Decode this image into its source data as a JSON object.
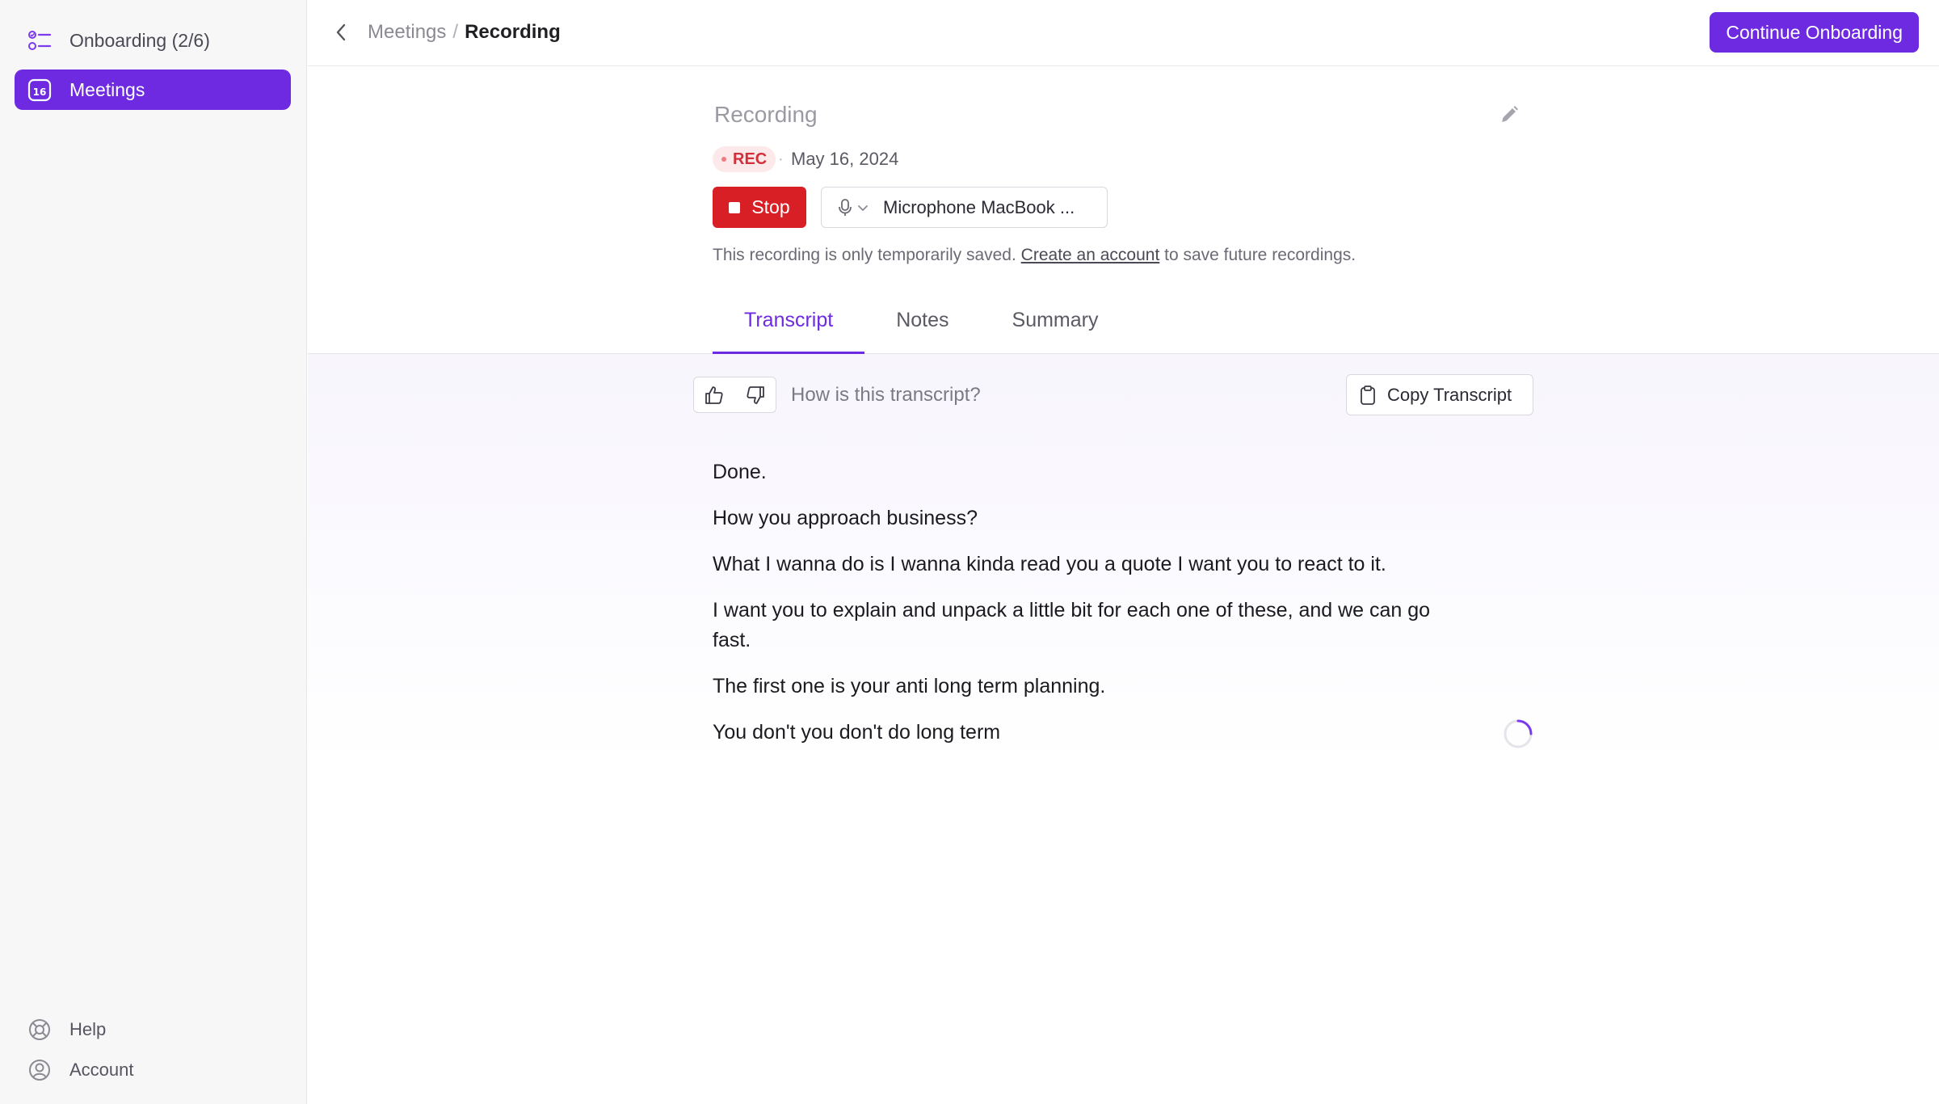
{
  "sidebar": {
    "items": [
      {
        "label": "Onboarding (2/6)",
        "icon": "checklist-icon"
      },
      {
        "label": "Meetings",
        "icon": "calendar-icon",
        "badge": "16"
      }
    ],
    "footer": [
      {
        "label": "Help",
        "icon": "lifebuoy-icon"
      },
      {
        "label": "Account",
        "icon": "user-circle-icon"
      }
    ]
  },
  "header": {
    "breadcrumb": {
      "parent": "Meetings",
      "separator": "/",
      "current": "Recording"
    },
    "continue_label": "Continue Onboarding"
  },
  "recording": {
    "title": "Recording",
    "badge": "REC",
    "dot": "·",
    "date": "May 16, 2024",
    "stop_label": "Stop",
    "mic_label": "Microphone MacBook ...",
    "notice_before": "This recording is only temporarily saved.",
    "notice_link": "Create an account",
    "notice_after": "to save future recordings."
  },
  "tabs": [
    {
      "label": "Transcript",
      "active": true
    },
    {
      "label": "Notes",
      "active": false
    },
    {
      "label": "Summary",
      "active": false
    }
  ],
  "feedback": {
    "question": "How is this transcript?"
  },
  "copy_label": "Copy Transcript",
  "transcript": [
    "Done.",
    "How you approach business?",
    "What I wanna do is I wanna kinda read you a quote I want you to react to it.",
    "I want you to explain and unpack a little bit for each one of these, and we can go fast.",
    "The first one is your anti long term planning.",
    "You don't you don't do long term"
  ],
  "colors": {
    "accent": "#6d2ae0",
    "stop": "#d91f26",
    "rec_text": "#d22f3a",
    "rec_bg": "#fde9ea"
  }
}
